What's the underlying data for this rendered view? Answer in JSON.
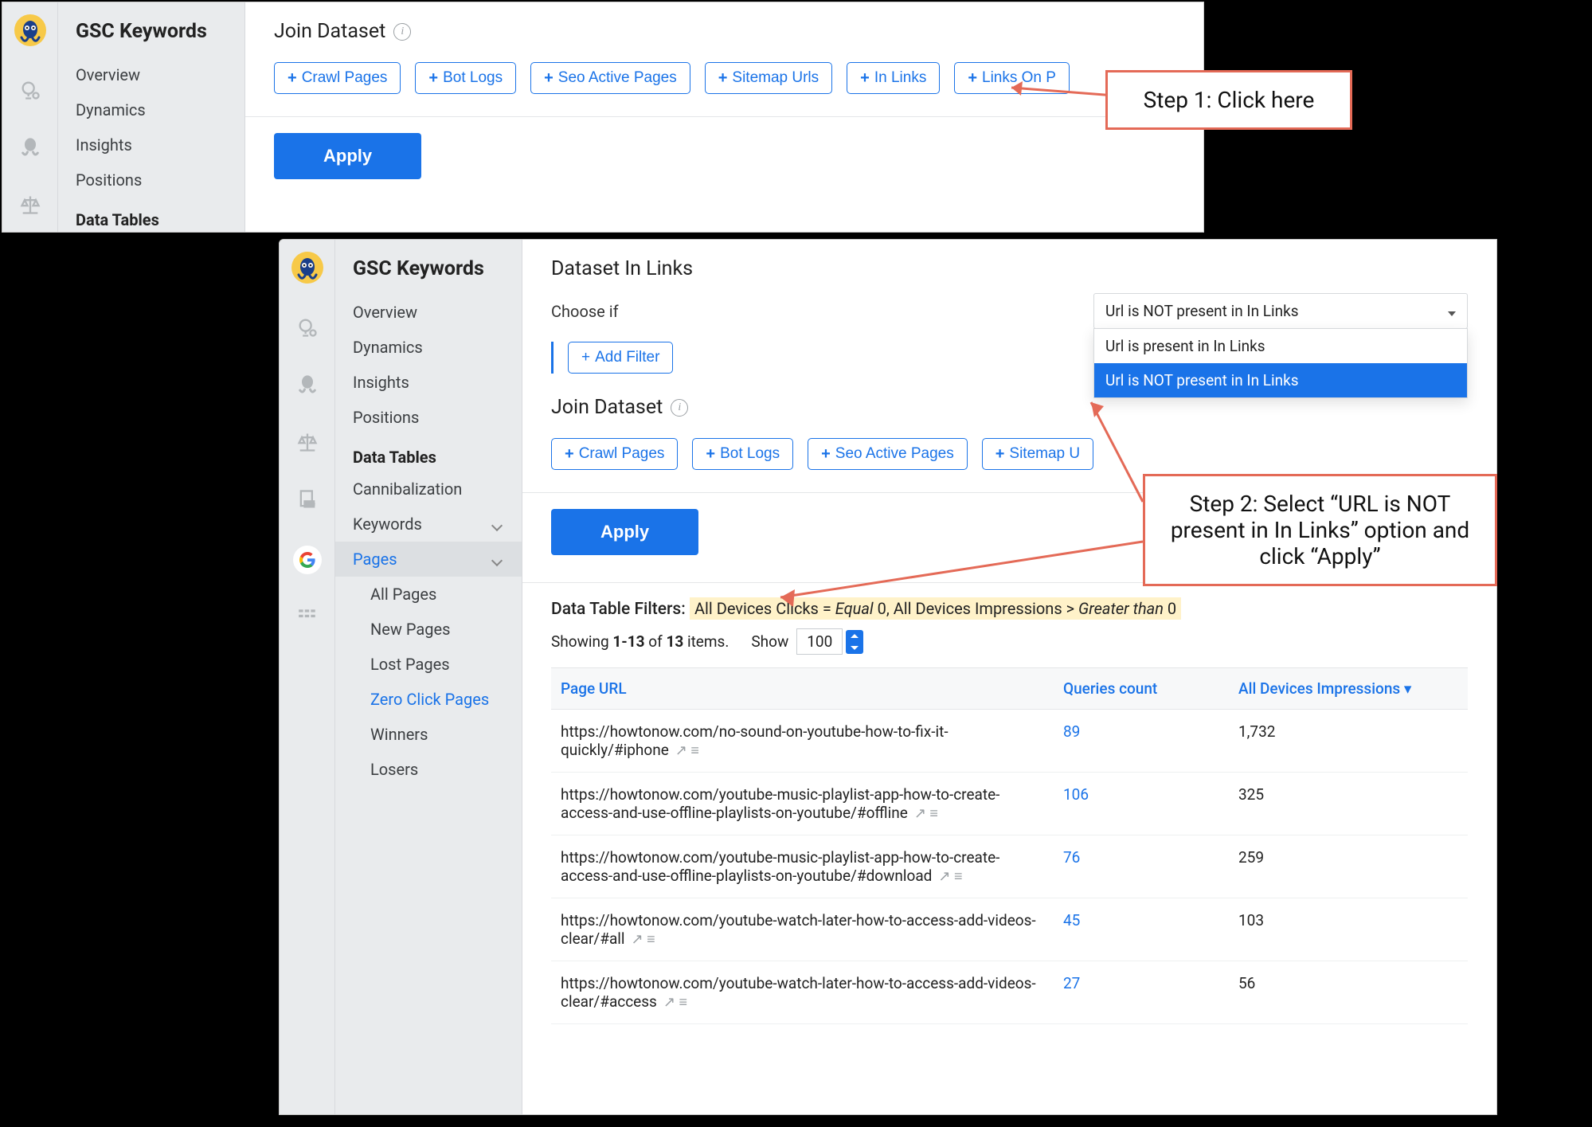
{
  "app": {
    "title": "GSC Keywords"
  },
  "sidebar": {
    "nav": [
      "Overview",
      "Dynamics",
      "Insights",
      "Positions"
    ],
    "section": "Data Tables",
    "items": [
      "Cannibalization",
      "Keywords",
      "Pages"
    ],
    "pages_sub": [
      "All Pages",
      "New Pages",
      "Lost Pages",
      "Zero Click Pages",
      "Winners",
      "Losers"
    ]
  },
  "join": {
    "title": "Join Dataset",
    "chips": [
      "Crawl Pages",
      "Bot Logs",
      "Seo Active Pages",
      "Sitemap Urls",
      "In Links",
      "Links On P"
    ]
  },
  "apply": "Apply",
  "callout1": "Step 1: Click here",
  "callout2": "Step 2: Select “URL is NOT present in In Links” option and click “Apply”",
  "dataset_inlinks": {
    "title": "Dataset In Links",
    "choose": "Choose if",
    "selected": "Url is NOT present in In Links",
    "options": [
      "Url is present in In Links",
      "Url is NOT present in In Links"
    ],
    "add_filter": "Add Filter"
  },
  "join2": {
    "title": "Join Dataset",
    "chips": [
      "Crawl Pages",
      "Bot Logs",
      "Seo Active Pages",
      "Sitemap U"
    ]
  },
  "filters": {
    "label": "Data Table Filters:",
    "html": "All Devices Clicks = <i>Equal</i> 0, All Devices Impressions > <i>Greater than</i> 0"
  },
  "pager": {
    "showing_pre": "Showing ",
    "range": "1-13",
    "of": " of ",
    "total": "13",
    "suffix": " items.",
    "show_label": "Show",
    "show_value": "100"
  },
  "table": {
    "headers": [
      "Page URL",
      "Queries count",
      "All Devices Impressions"
    ],
    "rows": [
      {
        "url": "https://howtonow.com/no-sound-on-youtube-how-to-fix-it-quickly/#iphone",
        "q": "89",
        "imp": "1,732"
      },
      {
        "url": "https://howtonow.com/youtube-music-playlist-app-how-to-create-access-and-use-offline-playlists-on-youtube/#offline",
        "q": "106",
        "imp": "325"
      },
      {
        "url": "https://howtonow.com/youtube-music-playlist-app-how-to-create-access-and-use-offline-playlists-on-youtube/#download",
        "q": "76",
        "imp": "259"
      },
      {
        "url": "https://howtonow.com/youtube-watch-later-how-to-access-add-videos-clear/#all",
        "q": "45",
        "imp": "103"
      },
      {
        "url": "https://howtonow.com/youtube-watch-later-how-to-access-add-videos-clear/#access",
        "q": "27",
        "imp": "56"
      }
    ]
  }
}
